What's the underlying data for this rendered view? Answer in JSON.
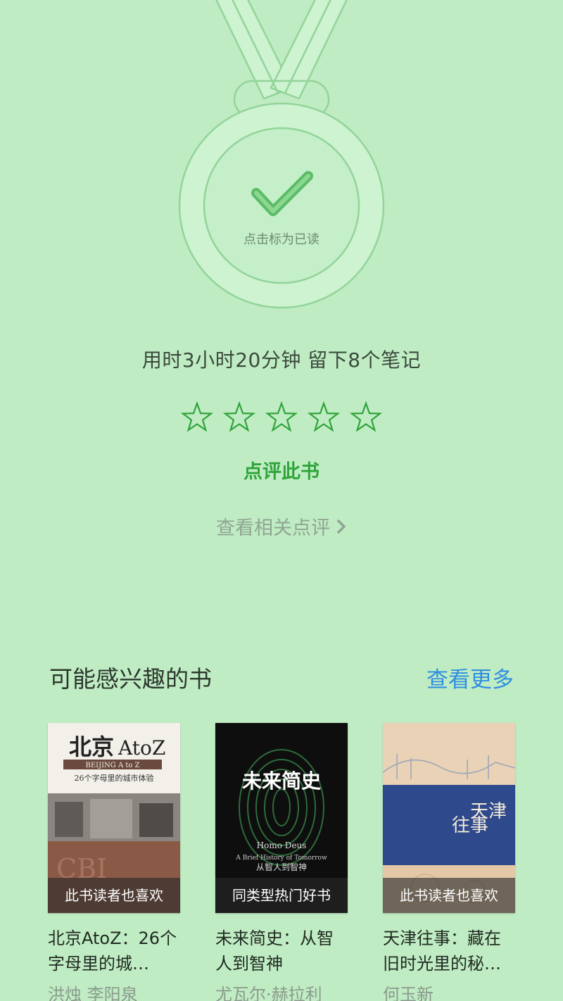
{
  "medal": {
    "label": "点击标为已读"
  },
  "stats": {
    "text": "用时3小时20分钟 留下8个笔记"
  },
  "rating": {
    "max_stars": 5,
    "value": 0
  },
  "review": {
    "label": "点评此书"
  },
  "related_reviews": {
    "label": "查看相关点评"
  },
  "recommend": {
    "title": "可能感兴趣的书",
    "see_more": "查看更多",
    "books": [
      {
        "tag": "此书读者也喜欢",
        "title": "北京AtoZ：26个字母里的城…",
        "author": "洪烛 李阳泉",
        "cover_text": {
          "main": "北京",
          "suffix": "AtoZ",
          "subtitle": "BEIJING A to Z",
          "line": "26个字母里的城市体验"
        }
      },
      {
        "tag": "同类型热门好书",
        "title": "未来简史：从智人到智神",
        "author": "尤瓦尔·赫拉利",
        "cover_text": {
          "main": "未来简史",
          "en": "Homo Deus",
          "en_sub": "A Brief History of Tomorrow",
          "cn_sub": "从智人到智神"
        }
      },
      {
        "tag": "此书读者也喜欢",
        "title": "天津往事：藏在旧时光里的秘…",
        "author": "何玉新",
        "cover_text": {
          "main1": "天津",
          "main2": "往事"
        }
      }
    ]
  },
  "colors": {
    "background": "#c0ecc4",
    "accent_green": "#2fa43a",
    "link_blue": "#2f8fe0"
  }
}
